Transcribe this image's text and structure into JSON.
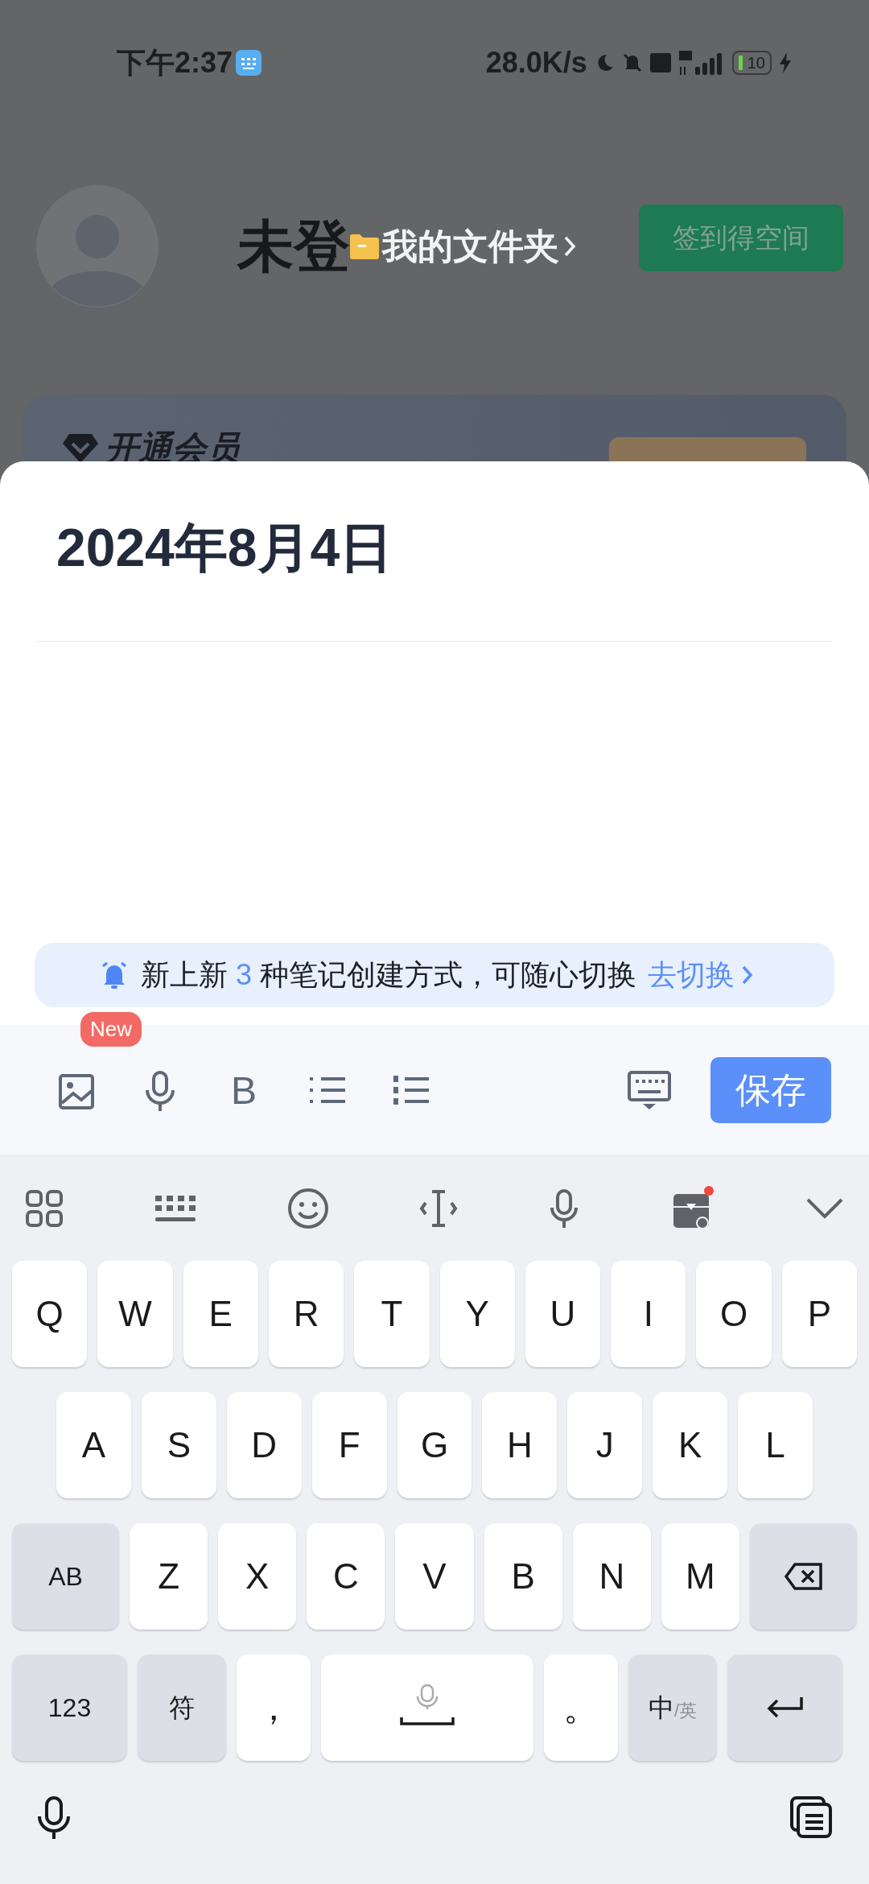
{
  "status_bar": {
    "time": "下午2:37",
    "network_speed": "28.0K/s",
    "battery": "10"
  },
  "profile": {
    "name": "未登",
    "folder_link": "我的文件夹",
    "checkin_button": "签到得空间"
  },
  "vip_card": {
    "title": "开通会员"
  },
  "note": {
    "title": "2024年8月4日"
  },
  "banner": {
    "prefix": "新上新",
    "count": "3",
    "suffix": "种笔记创建方式，可随心切换",
    "link": "去切换"
  },
  "toolbar": {
    "items": [
      {
        "kind": "image",
        "badge": "New"
      },
      {
        "kind": "voice"
      },
      {
        "kind": "bold",
        "glyph": "B"
      },
      {
        "kind": "bullet_list"
      },
      {
        "kind": "numbered_list"
      }
    ],
    "save_button": "保存"
  },
  "keyboard": {
    "rows": [
      [
        {
          "kind": "char",
          "label": "Q"
        },
        {
          "kind": "char",
          "label": "W"
        },
        {
          "kind": "char",
          "label": "E"
        },
        {
          "kind": "char",
          "label": "R"
        },
        {
          "kind": "char",
          "label": "T"
        },
        {
          "kind": "char",
          "label": "Y"
        },
        {
          "kind": "char",
          "label": "U"
        },
        {
          "kind": "char",
          "label": "I"
        },
        {
          "kind": "char",
          "label": "O"
        },
        {
          "kind": "char",
          "label": "P"
        }
      ],
      [
        {
          "kind": "char",
          "label": "A"
        },
        {
          "kind": "char",
          "label": "S"
        },
        {
          "kind": "char",
          "label": "D"
        },
        {
          "kind": "char",
          "label": "F"
        },
        {
          "kind": "char",
          "label": "G"
        },
        {
          "kind": "char",
          "label": "H"
        },
        {
          "kind": "char",
          "label": "J"
        },
        {
          "kind": "char",
          "label": "K"
        },
        {
          "kind": "char",
          "label": "L"
        }
      ],
      [
        {
          "kind": "function",
          "label": "AB"
        },
        {
          "kind": "char",
          "label": "Z"
        },
        {
          "kind": "char",
          "label": "X"
        },
        {
          "kind": "char",
          "label": "C"
        },
        {
          "kind": "char",
          "label": "V"
        },
        {
          "kind": "char",
          "label": "B"
        },
        {
          "kind": "char",
          "label": "N"
        },
        {
          "kind": "char",
          "label": "M"
        },
        {
          "kind": "backspace"
        }
      ],
      [
        {
          "kind": "function",
          "label": "123"
        },
        {
          "kind": "function",
          "label": "符"
        },
        {
          "kind": "char",
          "label": "，"
        },
        {
          "kind": "space"
        },
        {
          "kind": "char",
          "label": "。"
        },
        {
          "kind": "function",
          "label": "中",
          "sub": "/英"
        },
        {
          "kind": "enter"
        }
      ]
    ]
  }
}
